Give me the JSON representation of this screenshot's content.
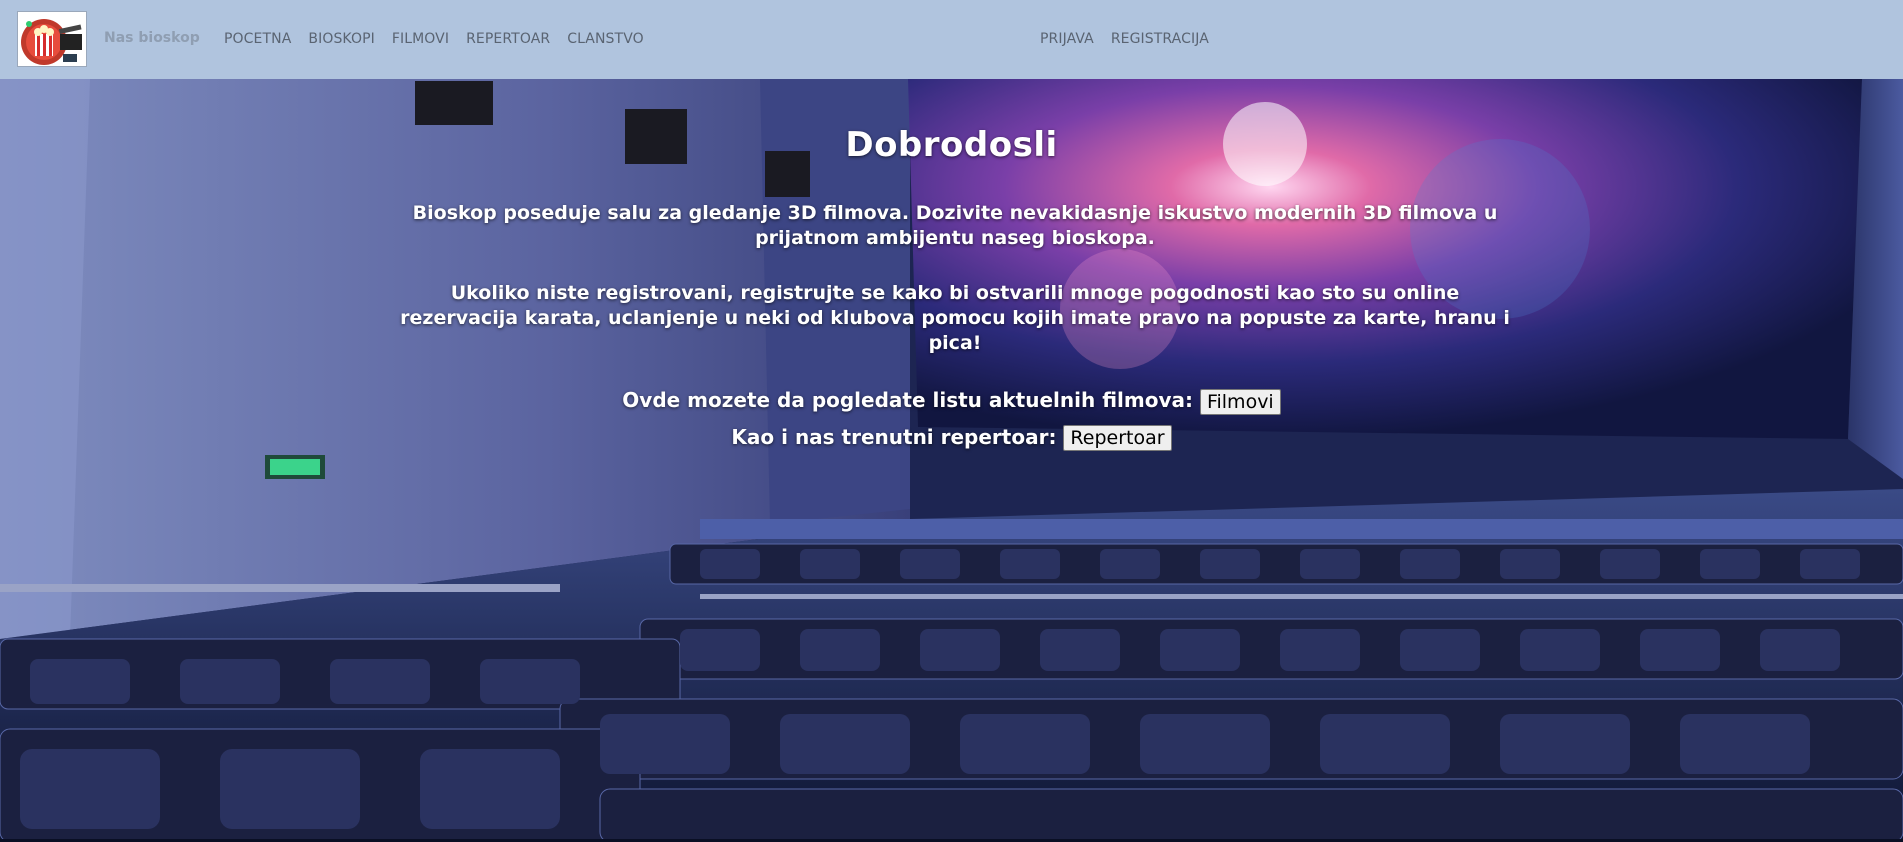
{
  "nav": {
    "brand": "Nas bioskop",
    "left_links": [
      "POCETNA",
      "BIOSKOPI",
      "FILMOVI",
      "REPERTOAR",
      "CLANSTVO"
    ],
    "right_links": [
      "PRIJAVA",
      "REGISTRACIJA"
    ]
  },
  "hero": {
    "title": "Dobrodosli",
    "paragraph1": "Bioskop poseduje salu za gledanje 3D filmova. Dozivite nevakidasnje iskustvo modernih 3D filmova u prijatnom ambijentu naseg bioskopa.",
    "paragraph2": "Ukoliko niste registrovani, registrujte se kako bi ostvarili mnoge pogodnosti kao sto su online rezervacija karata, uclanjenje u neki od klubova pomocu kojih imate pravo na popuste za karte, hranu i pica!",
    "films_prompt": "Ovde mozete da pogledate listu aktuelnih filmova:",
    "films_button": "Filmovi",
    "repertoire_prompt": "Kao i nas trenutni repertoar:",
    "repertoire_button": "Repertoar"
  },
  "colors": {
    "navbar_bg": "#b0c4de",
    "nav_link": "#5a6472",
    "brand": "#8f9eb2",
    "hero_text": "#ffffff"
  },
  "icons": {
    "logo": "popcorn-cinema-logo",
    "background": "cinema-hall-photo"
  }
}
